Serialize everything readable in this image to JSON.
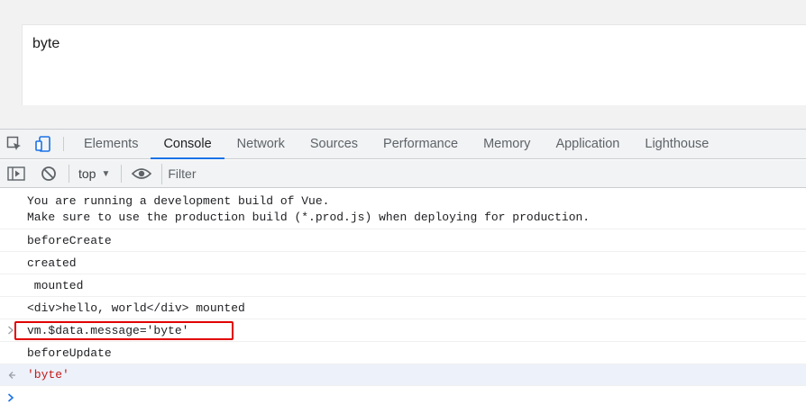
{
  "page": {
    "text": "byte"
  },
  "devtools": {
    "tabs": [
      {
        "label": "Elements"
      },
      {
        "label": "Console"
      },
      {
        "label": "Network"
      },
      {
        "label": "Sources"
      },
      {
        "label": "Performance"
      },
      {
        "label": "Memory"
      },
      {
        "label": "Application"
      },
      {
        "label": "Lighthouse"
      }
    ],
    "active_tab": "Console",
    "accent_color": "#1a73e8"
  },
  "toolbar": {
    "context": "top",
    "filter_placeholder": "Filter"
  },
  "console": {
    "warning": {
      "line1": "You are running a development build of Vue.",
      "line2": "Make sure to use the production build (*.prod.js) when deploying for production."
    },
    "logs": [
      "beforeCreate",
      "created",
      " mounted",
      "<div>hello, world</div> mounted"
    ],
    "command": "vm.$data.message='byte'",
    "log_after": "beforeUpdate",
    "result": "'byte'",
    "highlight_color": "#e10000"
  }
}
